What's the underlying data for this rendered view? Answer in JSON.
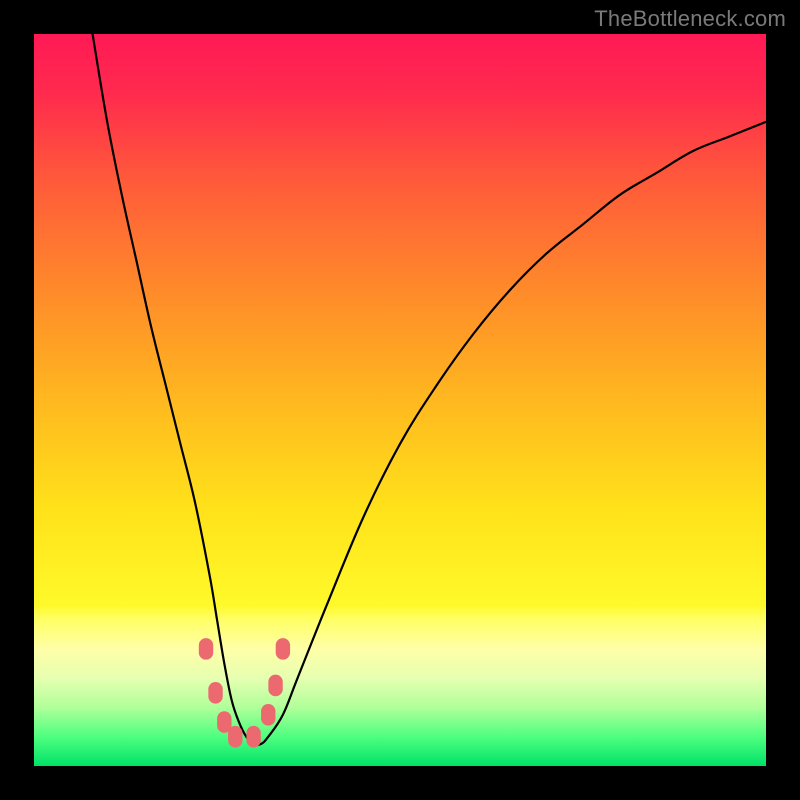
{
  "watermark": "TheBottleneck.com",
  "chart_data": {
    "type": "line",
    "title": "",
    "xlabel": "",
    "ylabel": "",
    "xlim": [
      0,
      100
    ],
    "ylim": [
      0,
      100
    ],
    "grid": false,
    "legend": false,
    "background_gradient": {
      "stops": [
        {
          "offset": 0.0,
          "color": "#ff1a55"
        },
        {
          "offset": 0.08,
          "color": "#ff2a4e"
        },
        {
          "offset": 0.2,
          "color": "#ff5a3a"
        },
        {
          "offset": 0.35,
          "color": "#ff8a2a"
        },
        {
          "offset": 0.5,
          "color": "#ffb81f"
        },
        {
          "offset": 0.65,
          "color": "#ffe21a"
        },
        {
          "offset": 0.78,
          "color": "#fff92a"
        },
        {
          "offset": 0.8,
          "color": "#ffff66"
        },
        {
          "offset": 0.84,
          "color": "#ffffa8"
        },
        {
          "offset": 0.88,
          "color": "#e6ffb0"
        },
        {
          "offset": 0.92,
          "color": "#b0ff9a"
        },
        {
          "offset": 0.96,
          "color": "#4eff80"
        },
        {
          "offset": 1.0,
          "color": "#00e268"
        }
      ]
    },
    "series": [
      {
        "name": "bottleneck-curve",
        "color": "#000000",
        "x": [
          8,
          10,
          12,
          14,
          16,
          18,
          20,
          22,
          24,
          25,
          26,
          27,
          28,
          29,
          30,
          31,
          32,
          34,
          36,
          40,
          45,
          50,
          55,
          60,
          65,
          70,
          75,
          80,
          85,
          90,
          95,
          100
        ],
        "y": [
          100,
          88,
          78,
          69,
          60,
          52,
          44,
          36,
          26,
          20,
          14,
          9,
          6,
          4,
          3,
          3,
          4,
          7,
          12,
          22,
          34,
          44,
          52,
          59,
          65,
          70,
          74,
          78,
          81,
          84,
          86,
          88
        ]
      }
    ],
    "markers": {
      "color": "#ec6a6f",
      "points_xy": [
        [
          23.5,
          16
        ],
        [
          24.8,
          10
        ],
        [
          26.0,
          6
        ],
        [
          27.5,
          4
        ],
        [
          30.0,
          4
        ],
        [
          32.0,
          7
        ],
        [
          33.0,
          11
        ],
        [
          34.0,
          16
        ]
      ],
      "radius_px": 9
    }
  }
}
